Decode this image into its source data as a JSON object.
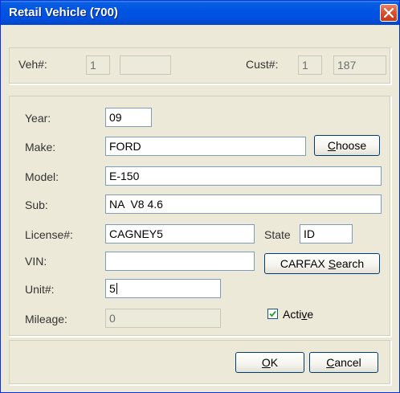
{
  "window": {
    "title": "Retail Vehicle (700)"
  },
  "header": {
    "veh_label": "Veh#:",
    "veh_value": "1",
    "veh_value2": "",
    "cust_label": "Cust#:",
    "cust_value": "1",
    "cust_value2": "187"
  },
  "form": {
    "year_label": "Year:",
    "year_value": "09",
    "make_label": "Make:",
    "make_value": "FORD",
    "choose_prefix": "",
    "choose_ul": "C",
    "choose_rest": "hoose",
    "model_label": "Model:",
    "model_value": "E-150",
    "sub_label": "Sub:",
    "sub_value": "NA  V8 4.6",
    "license_label": "License#:",
    "license_value": "CAGNEY5",
    "state_label": "State",
    "state_value": "ID",
    "vin_label": "VIN:",
    "vin_value": "",
    "carfax_prefix": "CARFAX ",
    "carfax_ul": "S",
    "carfax_rest": "earch",
    "unit_label": "Unit#:",
    "unit_value": "5",
    "mileage_label": "Mileage:",
    "mileage_value": "0",
    "active_prefix": "Acti",
    "active_ul": "v",
    "active_rest": "e",
    "active_checked": true
  },
  "footer": {
    "ok_ul": "O",
    "ok_rest": "K",
    "cancel_ul": "C",
    "cancel_rest": "ancel"
  }
}
